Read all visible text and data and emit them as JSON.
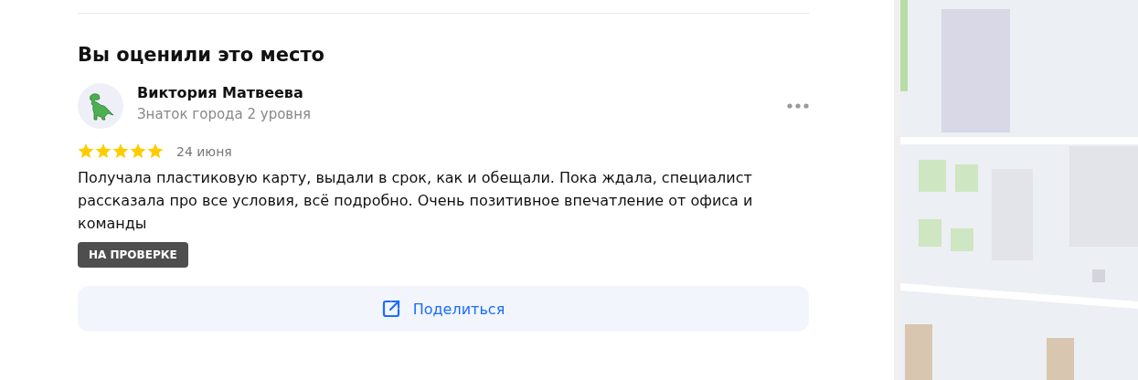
{
  "section_title": "Вы оценили это место",
  "review": {
    "author": "Виктория Матвеева",
    "author_level": "Знаток города 2 уровня",
    "stars": 5,
    "date": "24 июня",
    "text": "Получала пластиковую карту, выдали в срок, как и обещали. Пока ждала, специалист рассказала про все условия, всё подробно. Очень позитивное впечатление от офиса и команды",
    "status_badge": "НА ПРОВЕРКЕ"
  },
  "share_button": {
    "label": "Поделиться"
  }
}
